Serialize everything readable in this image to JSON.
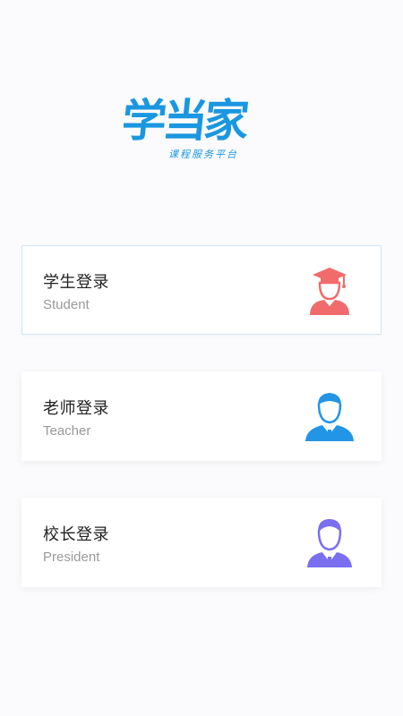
{
  "app": {
    "logo_text": "学当家",
    "logo_subtitle": "课程服务平台"
  },
  "login_options": [
    {
      "title": "学生登录",
      "subtitle": "Student",
      "icon": "student-graduate-icon",
      "icon_color": "#f06b6b",
      "selected": true
    },
    {
      "title": "老师登录",
      "subtitle": "Teacher",
      "icon": "teacher-icon",
      "icon_color": "#2295e6",
      "selected": false
    },
    {
      "title": "校长登录",
      "subtitle": "President",
      "icon": "president-icon",
      "icon_color": "#7a6ff0",
      "selected": false
    }
  ],
  "colors": {
    "brand_blue": "#1a97e0",
    "selected_border": "#cfe6f7",
    "background": "#fbfbfd"
  }
}
